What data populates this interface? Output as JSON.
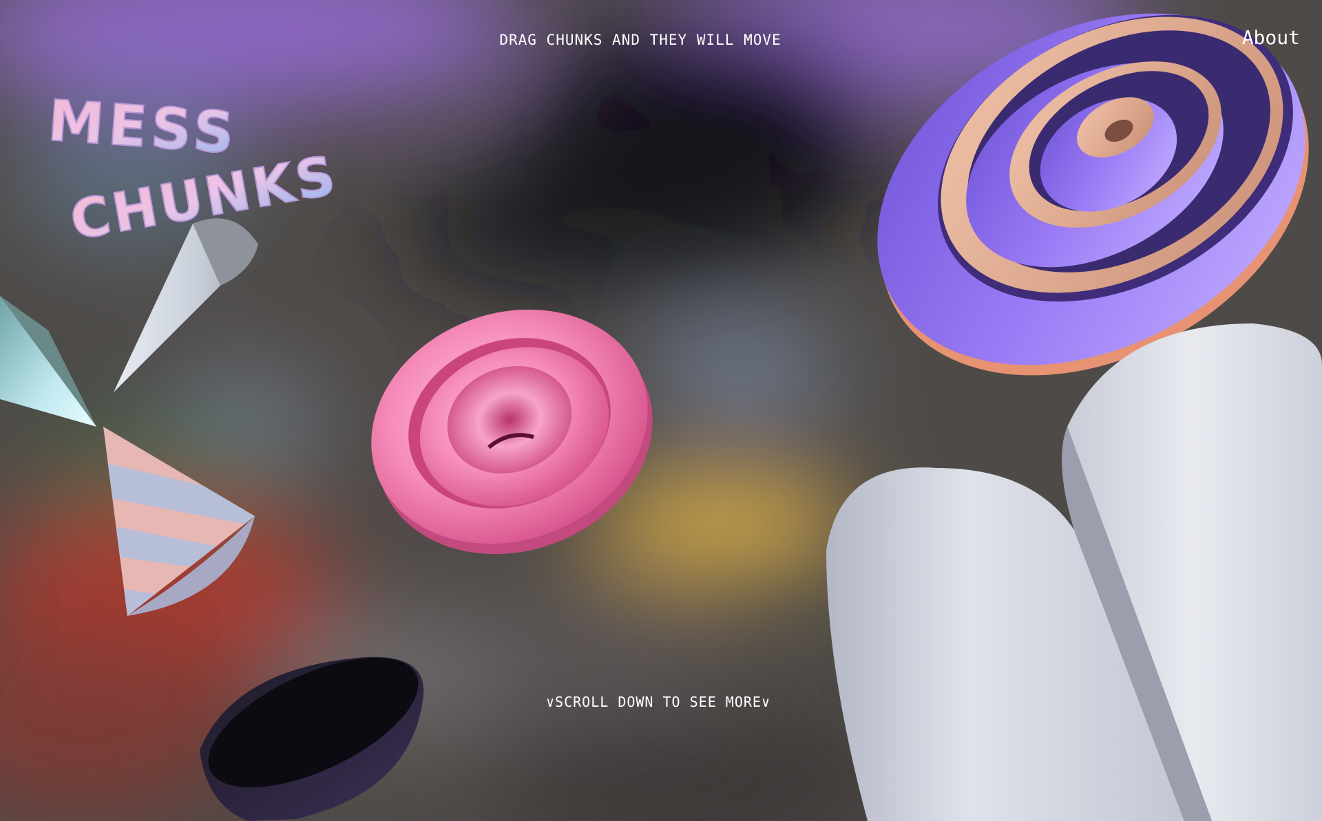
{
  "header": {
    "hint": "DRAG CHUNKS AND THEY WILL MOVE",
    "about_label": "About"
  },
  "logo": {
    "line1": "MESS",
    "line2": "CHUNKS"
  },
  "footer": {
    "scroll_hint": "∨SCROLL DOWN TO SEE MORE∨"
  },
  "colors": {
    "pink": "#f58bb8",
    "purple": "#8a6cf0",
    "peach": "#e9b49a",
    "grey": "#c9cdd8"
  }
}
